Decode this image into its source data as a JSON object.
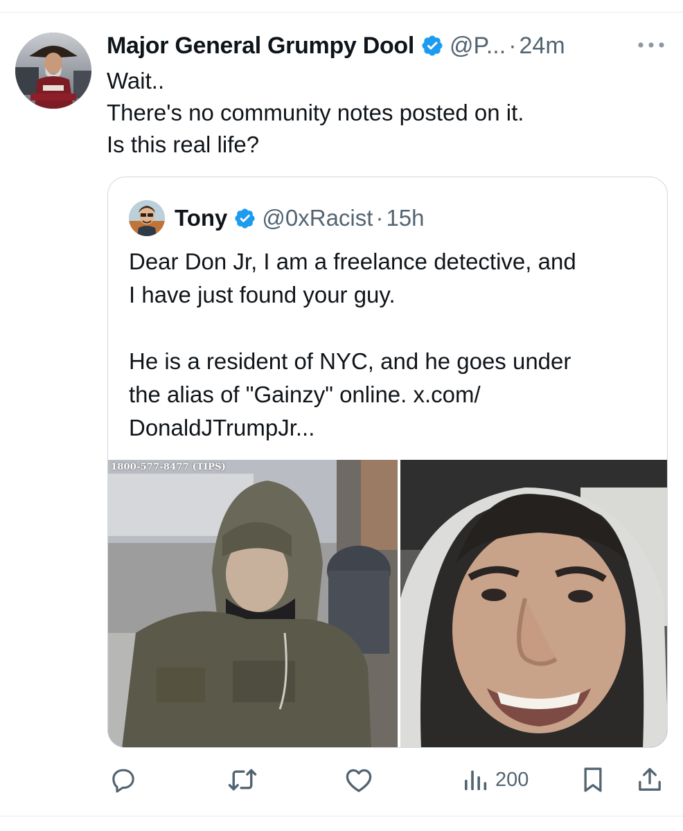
{
  "tweet": {
    "display_name": "Major General Grumpy Dool",
    "handle": "@P...",
    "separator": "·",
    "time": "24m",
    "text_lines": [
      "Wait..",
      "There's no community notes posted on it.",
      "Is this real life?"
    ],
    "more_icon": "more-horizontal-icon",
    "avatar_icon": "profile-photo"
  },
  "quote": {
    "display_name": "Tony",
    "handle": "@0xRacist",
    "separator": "·",
    "time": "15h",
    "text_lines": [
      "Dear Don Jr, I am a freelance detective, and",
      "I have just found your guy.",
      "",
      "He is a resident of NYC, and he goes under",
      "the alias of \"Gainzy\" online. x.com/",
      "DonaldJTrumpJr..."
    ],
    "media": {
      "left_image_caption": "1800-577-8477 (TIPS)",
      "left_image_icon": "surveillance-photo",
      "right_image_icon": "selfie-photo"
    }
  },
  "actions": {
    "reply_icon": "reply-icon",
    "retweet_icon": "retweet-icon",
    "like_icon": "like-icon",
    "views_icon": "views-icon",
    "views_count": "200",
    "bookmark_icon": "bookmark-icon",
    "share_icon": "share-icon"
  },
  "colors": {
    "verified_blue": "#1d9bf0",
    "secondary_text": "#536471",
    "border": "#cfd9de"
  }
}
